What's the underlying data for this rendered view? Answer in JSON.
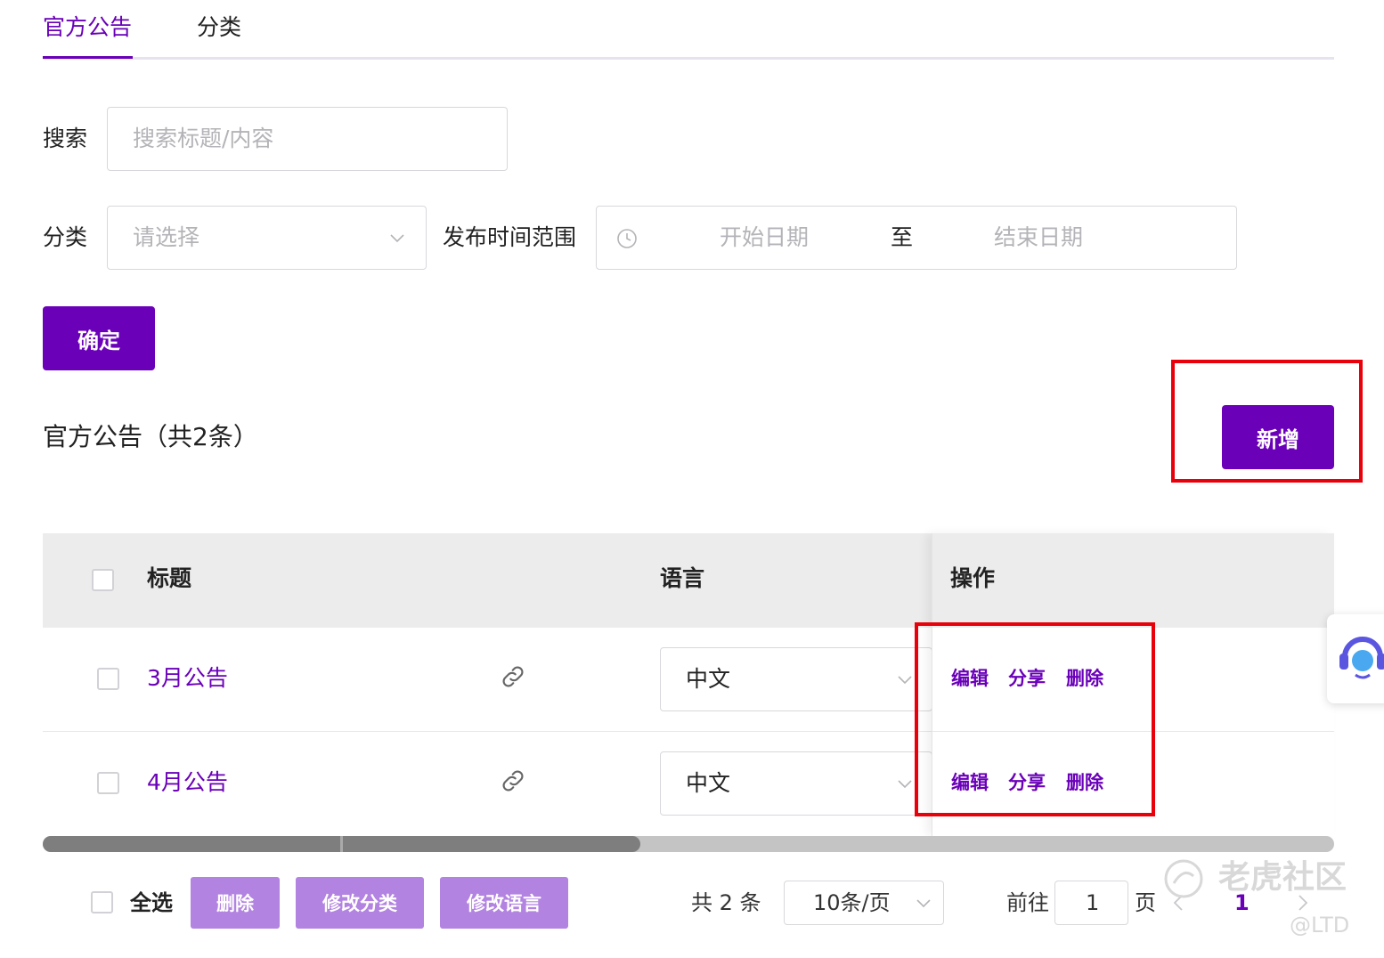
{
  "tabs": [
    {
      "label": "官方公告"
    },
    {
      "label": "分类"
    }
  ],
  "filters": {
    "search_label": "搜索",
    "search_placeholder": "搜索标题/内容",
    "category_label": "分类",
    "category_placeholder": "请选择",
    "date_range_label": "发布时间范围",
    "start_placeholder": "开始日期",
    "range_separator": "至",
    "end_placeholder": "结束日期",
    "confirm_label": "确定"
  },
  "section": {
    "title": "官方公告（共2条）",
    "add_label": "新增"
  },
  "table": {
    "headers": {
      "title": "标题",
      "language": "语言",
      "actions": "操作"
    },
    "rows": [
      {
        "title": "3月公告",
        "language": "中文",
        "actions": [
          "编辑",
          "分享",
          "删除"
        ]
      },
      {
        "title": "4月公告",
        "language": "中文",
        "actions": [
          "编辑",
          "分享",
          "删除"
        ]
      }
    ]
  },
  "footer": {
    "select_all": "全选",
    "delete_label": "删除",
    "edit_category_label": "修改分类",
    "edit_language_label": "修改语言",
    "total_text": "共 2 条",
    "page_size": "10条/页",
    "goto_label": "前往",
    "goto_value": "1",
    "page_suffix": "页",
    "current_page": "1"
  },
  "watermark": {
    "text": "老虎社区",
    "handle": "@LTD"
  },
  "colors": {
    "primary": "#6a00b8",
    "primary_light": "#b283e0",
    "highlight_box": "#e8000b"
  }
}
